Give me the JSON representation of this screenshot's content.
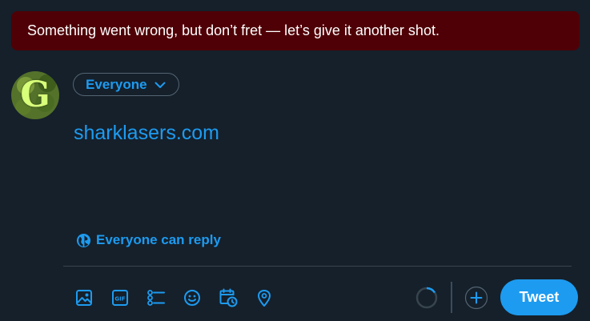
{
  "error_banner": {
    "message": "Something went wrong, but don’t fret — let’s give it another shot."
  },
  "avatar": {
    "letter": "G"
  },
  "audience": {
    "label": "Everyone"
  },
  "composer": {
    "text": "sharklasers.com"
  },
  "reply_setting": {
    "label": "Everyone can reply"
  },
  "toolbar": {
    "icons": [
      "image-icon",
      "gif-icon",
      "poll-icon",
      "emoji-icon",
      "schedule-icon",
      "location-icon"
    ],
    "tweet_label": "Tweet"
  },
  "colors": {
    "accent": "#1d9bf0",
    "background": "#15202b",
    "error_background": "#4f0006",
    "border": "#38444d"
  }
}
